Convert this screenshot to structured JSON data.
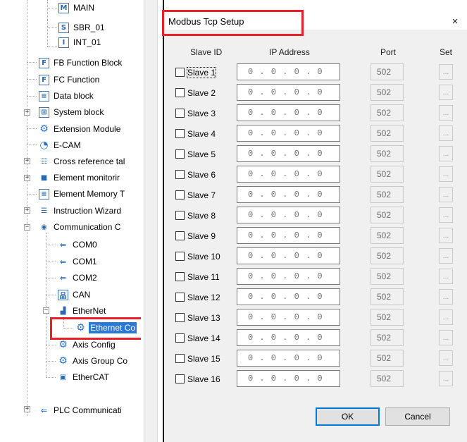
{
  "tree": {
    "items": [
      {
        "label": "MAIN",
        "icon": "M"
      },
      {
        "label": "SBR_01",
        "icon": "S"
      },
      {
        "label": "INT_01",
        "icon": "I"
      },
      {
        "label": "FB Function Block",
        "icon": "F"
      },
      {
        "label": "FC Function",
        "icon": "F"
      },
      {
        "label": "Data block",
        "icon": "≡"
      },
      {
        "label": "System block",
        "icon": "⊞"
      },
      {
        "label": "Extension Module",
        "icon": "⚙"
      },
      {
        "label": "E-CAM",
        "icon": "◔"
      },
      {
        "label": "Cross reference tal",
        "icon": "☷"
      },
      {
        "label": "Element monitorir",
        "icon": "■"
      },
      {
        "label": "Element Memory T",
        "icon": "≡"
      },
      {
        "label": "Instruction Wizard",
        "icon": "☰"
      },
      {
        "label": "Communication C",
        "icon": "◉"
      },
      {
        "label": "COM0",
        "icon": "⇐"
      },
      {
        "label": "COM1",
        "icon": "⇐"
      },
      {
        "label": "COM2",
        "icon": "⇐"
      },
      {
        "label": "CAN",
        "icon": "品"
      },
      {
        "label": "EtherNet",
        "icon": "▟"
      },
      {
        "label": "Ethernet Co",
        "icon": "⚙"
      },
      {
        "label": "Axis Config",
        "icon": "⚙"
      },
      {
        "label": "Axis Group Co",
        "icon": "⚙"
      },
      {
        "label": "EtherCAT",
        "icon": "▣"
      },
      {
        "label": "PLC Communicati",
        "icon": "⇐"
      }
    ]
  },
  "dialog": {
    "title": "Modbus Tcp Setup",
    "close": "×",
    "headers": {
      "slave_id": "Slave ID",
      "ip": "IP Address",
      "port": "Port",
      "set": "Set"
    },
    "rows": [
      {
        "label": "Slave 1",
        "ip": "0 . 0 . 0 . 0",
        "port": "502",
        "set": "..."
      },
      {
        "label": "Slave 2",
        "ip": "0 . 0 . 0 . 0",
        "port": "502",
        "set": "..."
      },
      {
        "label": "Slave 3",
        "ip": "0 . 0 . 0 . 0",
        "port": "502",
        "set": "..."
      },
      {
        "label": "Slave 4",
        "ip": "0 . 0 . 0 . 0",
        "port": "502",
        "set": "..."
      },
      {
        "label": "Slave 5",
        "ip": "0 . 0 . 0 . 0",
        "port": "502",
        "set": "..."
      },
      {
        "label": "Slave 6",
        "ip": "0 . 0 . 0 . 0",
        "port": "502",
        "set": "..."
      },
      {
        "label": "Slave 7",
        "ip": "0 . 0 . 0 . 0",
        "port": "502",
        "set": "..."
      },
      {
        "label": "Slave 8",
        "ip": "0 . 0 . 0 . 0",
        "port": "502",
        "set": "..."
      },
      {
        "label": "Slave 9",
        "ip": "0 . 0 . 0 . 0",
        "port": "502",
        "set": "..."
      },
      {
        "label": "Slave 10",
        "ip": "0 . 0 . 0 . 0",
        "port": "502",
        "set": "..."
      },
      {
        "label": "Slave 11",
        "ip": "0 . 0 . 0 . 0",
        "port": "502",
        "set": "..."
      },
      {
        "label": "Slave 12",
        "ip": "0 . 0 . 0 . 0",
        "port": "502",
        "set": "..."
      },
      {
        "label": "Slave 13",
        "ip": "0 . 0 . 0 . 0",
        "port": "502",
        "set": "..."
      },
      {
        "label": "Slave 14",
        "ip": "0 . 0 . 0 . 0",
        "port": "502",
        "set": "..."
      },
      {
        "label": "Slave 15",
        "ip": "0 . 0 . 0 . 0",
        "port": "502",
        "set": "..."
      },
      {
        "label": "Slave 16",
        "ip": "0 . 0 . 0 . 0",
        "port": "502",
        "set": "..."
      }
    ],
    "ok": "OK",
    "cancel": "Cancel"
  },
  "colors": {
    "highlight": "#e8202a",
    "selection": "#2b79d6",
    "accent": "#0078d7"
  }
}
